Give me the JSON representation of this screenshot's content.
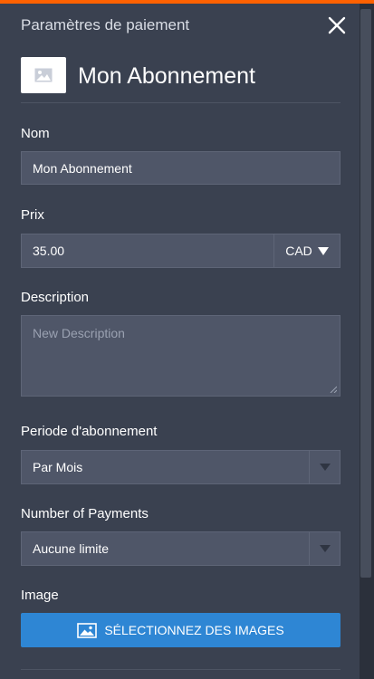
{
  "header": {
    "title": "Paramètres de paiement"
  },
  "product": {
    "name": "Mon Abonnement"
  },
  "fields": {
    "name": {
      "label": "Nom",
      "value": "Mon Abonnement"
    },
    "price": {
      "label": "Prix",
      "value": "35.00",
      "currency": "CAD"
    },
    "description": {
      "label": "Description",
      "placeholder": "New Description"
    },
    "period": {
      "label": "Periode d'abonnement",
      "value": "Par Mois"
    },
    "payments": {
      "label": "Number of Payments",
      "value": "Aucune limite"
    },
    "image": {
      "label": "Image",
      "button_label": "SÉLECTIONNEZ DES IMAGES"
    }
  },
  "colors": {
    "accent_top": "#ff6100",
    "button": "#2e86d4",
    "panel": "#3a4150",
    "field": "#4f5668"
  },
  "icons": [
    "close-icon",
    "image-placeholder-icon",
    "caret-down-icon",
    "chevron-down-icon",
    "image-icon"
  ]
}
